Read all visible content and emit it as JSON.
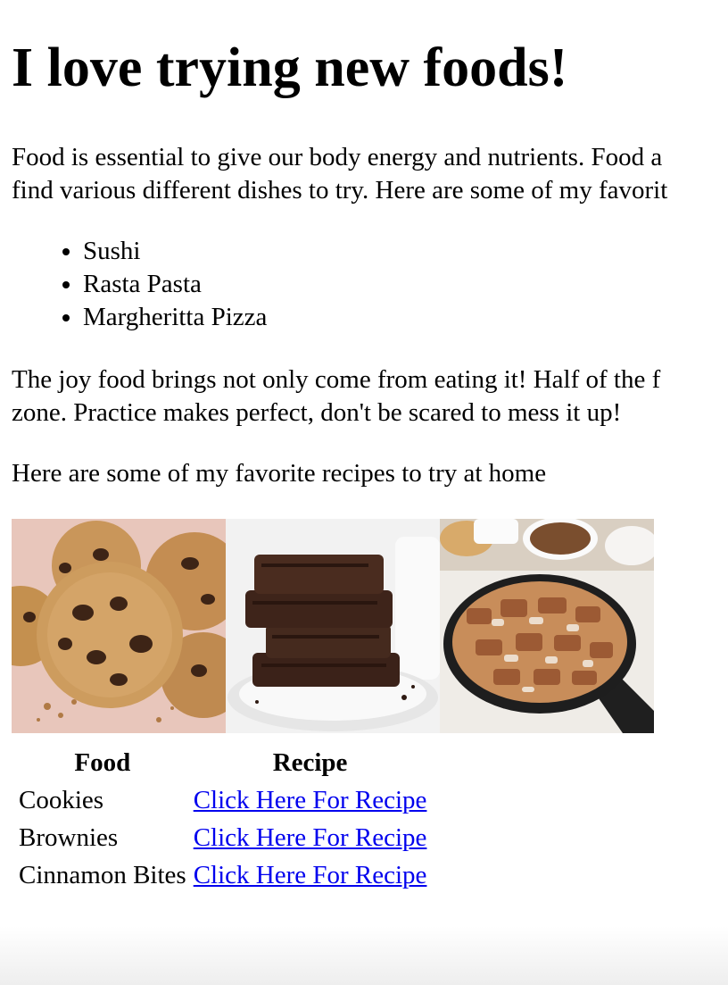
{
  "heading": "I love trying new foods!",
  "intro": "Food is essential to give our body energy and nutrients. Food a",
  "intro_line2": "find various different dishes to try. Here are some of my favorit",
  "favorites": [
    "Sushi",
    "Rasta Pasta",
    "Margheritta Pizza"
  ],
  "joy_line1": "The joy food brings not only come from eating it! Half of the f",
  "joy_line2": "zone. Practice makes perfect, don't be scared to mess it up!",
  "recipes_intro": "Here are some of my favorite recipes to try at home",
  "gallery": [
    {
      "name": "cookies-image"
    },
    {
      "name": "brownies-image"
    },
    {
      "name": "cinnamon-bites-image"
    }
  ],
  "table": {
    "headers": [
      "Food",
      "Recipe"
    ],
    "rows": [
      {
        "food": "Cookies",
        "link": "Click Here For Recipe"
      },
      {
        "food": "Brownies",
        "link": "Click Here For Recipe"
      },
      {
        "food": "Cinnamon Bites",
        "link": "Click Here For Recipe"
      }
    ]
  },
  "colors": {
    "link": "#0000ee",
    "text": "#000000",
    "background": "#ffffff"
  }
}
